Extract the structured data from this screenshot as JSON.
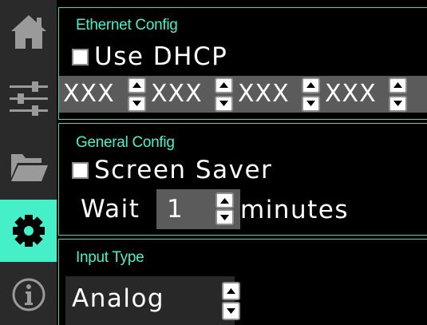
{
  "sidebar": {
    "items": [
      {
        "icon": "home-icon",
        "active": false
      },
      {
        "icon": "sliders-icon",
        "active": false
      },
      {
        "icon": "folder-icon",
        "active": false
      },
      {
        "icon": "gear-icon",
        "active": true
      },
      {
        "icon": "info-icon",
        "active": false
      }
    ]
  },
  "ethernet": {
    "title": "Ethernet Config",
    "dhcp_label": "Use DHCP",
    "dhcp_checked": false,
    "ip_octets": [
      "XXX",
      "XXX",
      "XXX",
      "XXX"
    ]
  },
  "general": {
    "title": "General Config",
    "screensaver_label": "Screen Saver",
    "screensaver_checked": false,
    "wait_label": "Wait",
    "wait_value": "1",
    "minutes_label": "minutes"
  },
  "input": {
    "title": "Input Type",
    "value": "Analog"
  },
  "colors": {
    "accent": "#45f0c9",
    "sidebar_bg": "#2a2a2a",
    "field_bg": "#5b5b5b"
  }
}
